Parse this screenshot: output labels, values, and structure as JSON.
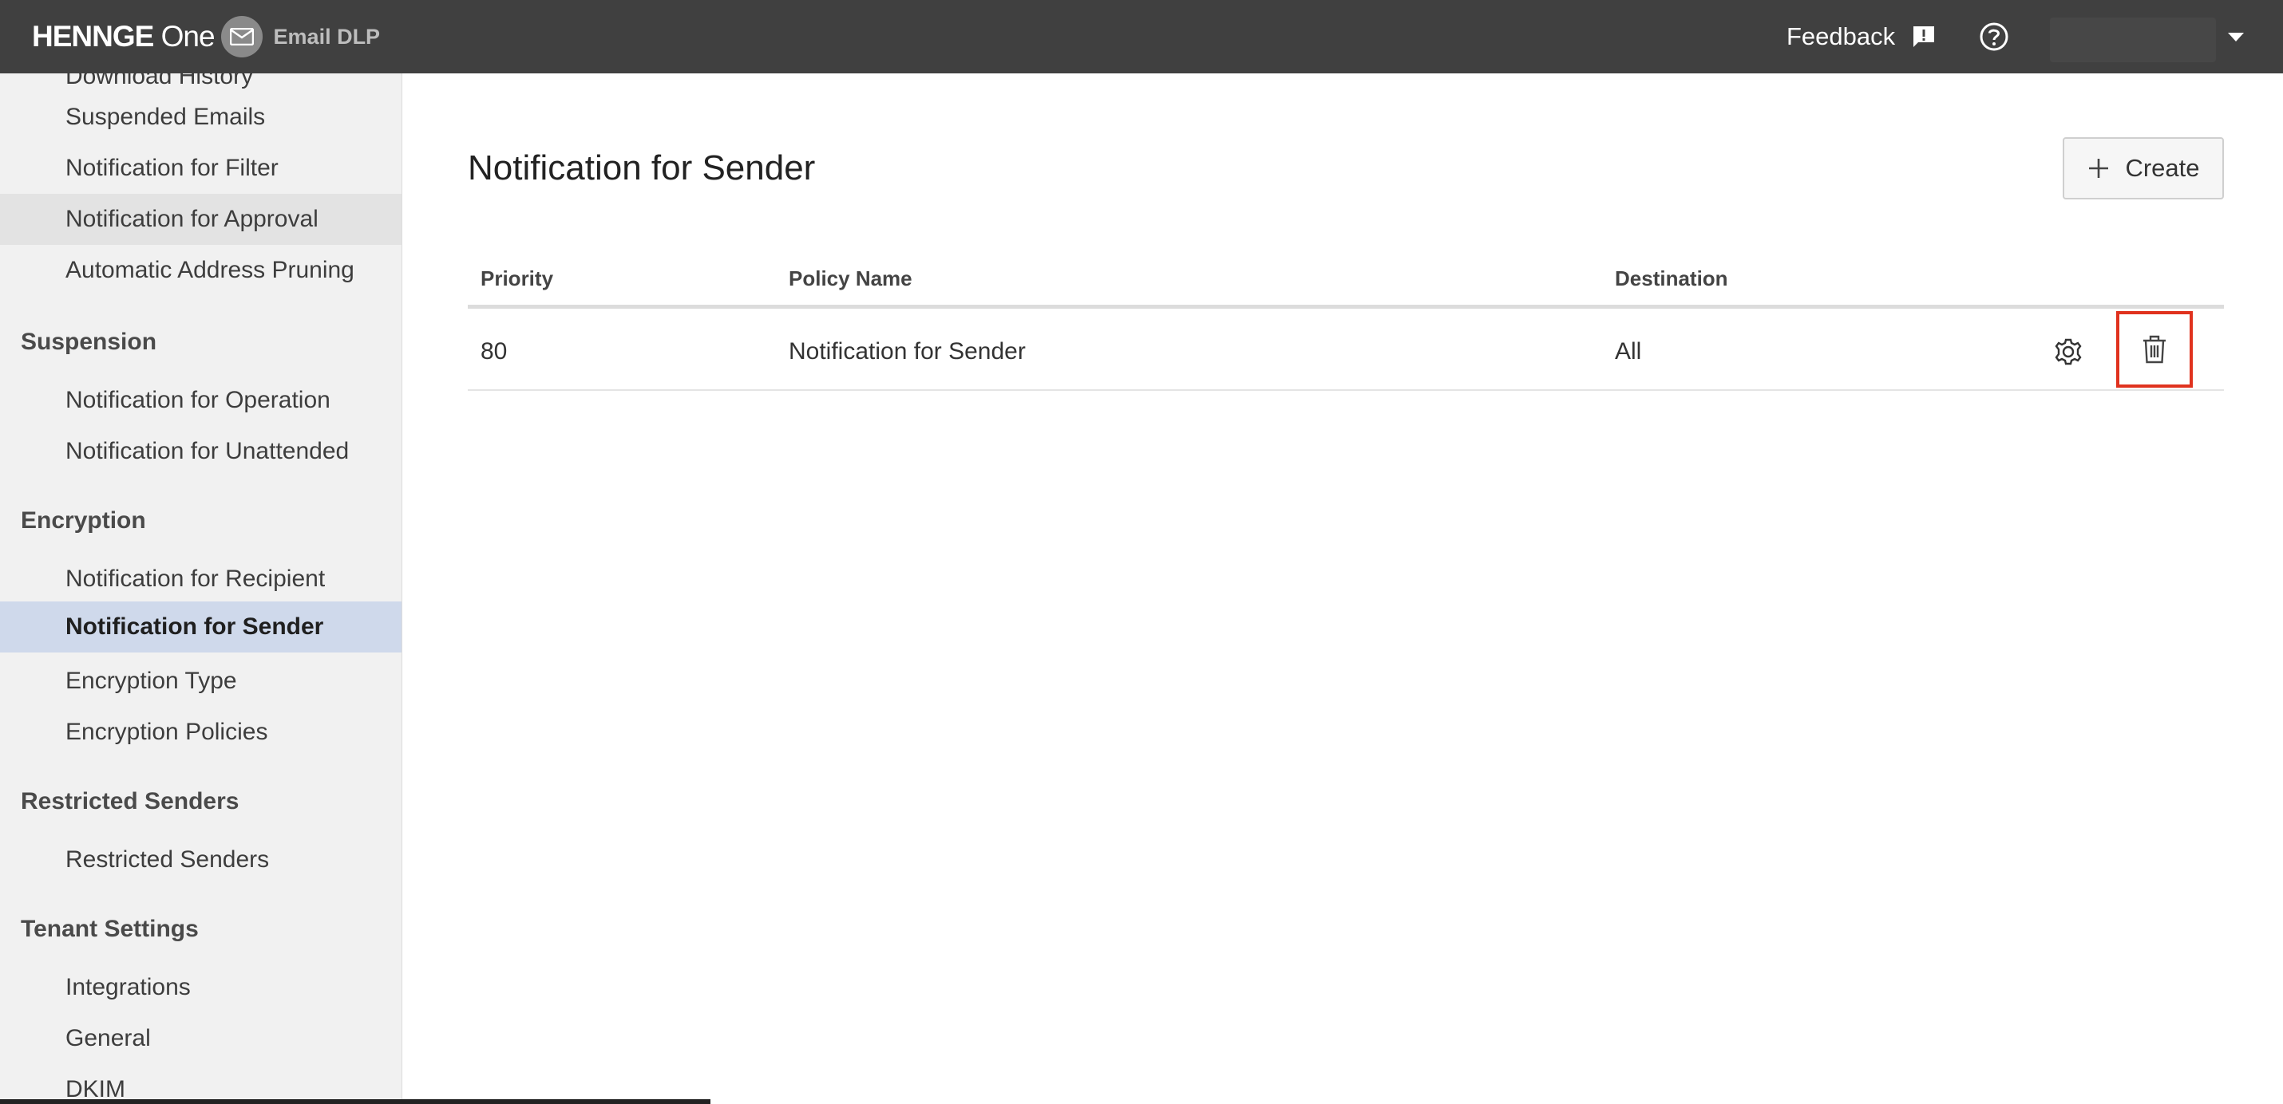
{
  "header": {
    "brand": "HENNGE",
    "brand_suffix": "One",
    "product": "Email DLP",
    "feedback_label": "Feedback",
    "icons": [
      "mail-icon",
      "feedback-icon",
      "help-icon",
      "caret-down-icon"
    ]
  },
  "sidebar": {
    "items_top": [
      {
        "label": "Download History"
      },
      {
        "label": "Suspended Emails"
      },
      {
        "label": "Notification for Filter"
      },
      {
        "label": "Notification for Approval"
      },
      {
        "label": "Automatic Address Pruning"
      }
    ],
    "sections": [
      {
        "title": "Suspension",
        "items": [
          "Notification for Operation",
          "Notification for Unattended"
        ]
      },
      {
        "title": "Encryption",
        "items": [
          "Notification for Recipient",
          "Notification for Sender",
          "Encryption Type",
          "Encryption Policies"
        ]
      },
      {
        "title": "Restricted Senders",
        "items": [
          "Restricted Senders"
        ]
      },
      {
        "title": "Tenant Settings",
        "items": [
          "Integrations",
          "General",
          "DKIM"
        ]
      }
    ],
    "active_item": "Notification for Sender",
    "hovered_item": "Notification for Approval"
  },
  "main": {
    "title": "Notification for Sender",
    "create_label": "Create",
    "columns": [
      "Priority",
      "Policy Name",
      "Destination"
    ],
    "rows": [
      {
        "priority": "80",
        "policy_name": "Notification for Sender",
        "destination": "All"
      }
    ],
    "row_actions": [
      "gear-icon",
      "trash-icon"
    ]
  },
  "colors": {
    "topbar": "#404040",
    "sidebar": "#f1f1f1",
    "active_item": "#cfd9eb",
    "highlight": "#e0321e"
  }
}
